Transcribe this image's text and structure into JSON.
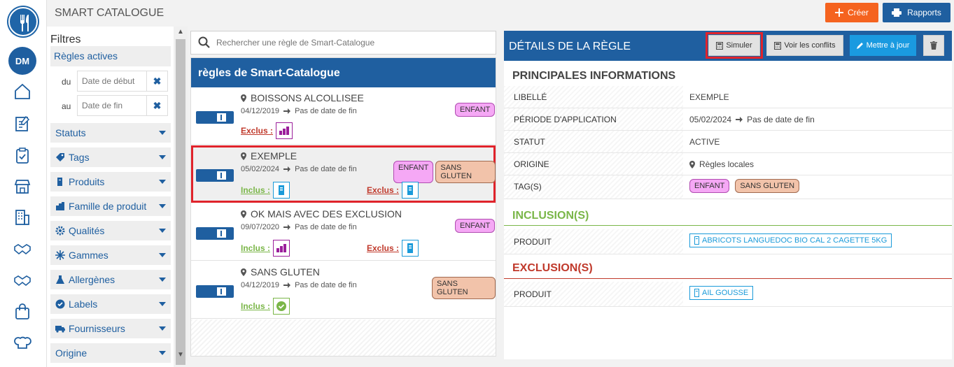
{
  "app": {
    "title": "SMART CATALOGUE",
    "avatar": "DM",
    "create_label": "Créer",
    "reports_label": "Rapports"
  },
  "filters": {
    "title": "Filtres",
    "active_rules": "Règles actives",
    "from_label": "du",
    "from_placeholder": "Date de début",
    "to_label": "au",
    "to_placeholder": "Date de fin",
    "facets": [
      "Statuts",
      "Tags",
      "Produits",
      "Famille de produit",
      "Qualités",
      "Gammes",
      "Allergènes",
      "Labels",
      "Fournisseurs",
      "Origine"
    ]
  },
  "search": {
    "placeholder": "Rechercher une règle de Smart-Catalogue"
  },
  "list": {
    "title": "règles de Smart-Catalogue",
    "no_end": "Pas de date de fin",
    "incl_label": "Inclus :",
    "excl_label": "Exclus :",
    "rules": [
      {
        "name": "BOISSONS ALCOLLISEE",
        "date": "04/12/2019",
        "tags": [
          "ENFANT"
        ]
      },
      {
        "name": "EXEMPLE",
        "date": "05/02/2024",
        "tags": [
          "ENFANT",
          "SANS GLUTEN"
        ]
      },
      {
        "name": "OK MAIS AVEC DES EXCLUSION",
        "date": "09/07/2020",
        "tags": [
          "ENFANT"
        ]
      },
      {
        "name": "SANS GLUTEN",
        "date": "04/12/2019",
        "tags": [
          "SANS GLUTEN"
        ]
      }
    ]
  },
  "detail": {
    "title": "DÉTAILS DE LA RÈGLE",
    "simulate": "Simuler",
    "conflicts": "Voir les conflits",
    "update": "Mettre à jour",
    "main_info": "PRINCIPALES INFORMATIONS",
    "rows": [
      {
        "k": "LIBELLÉ",
        "v": "EXEMPLE"
      },
      {
        "k": "PÉRIODE D'APPLICATION",
        "v": "05/02/2024",
        "v2": "Pas de date de fin"
      },
      {
        "k": "STATUT",
        "v": "ACTIVE"
      },
      {
        "k": "ORIGINE",
        "v": "Règles locales"
      },
      {
        "k": "TAG(S)",
        "tags": [
          "ENFANT",
          "SANS GLUTEN"
        ]
      }
    ],
    "inclusions_title": "INCLUSION(S)",
    "inclusion": {
      "k": "PRODUIT",
      "v": "ABRICOTS LANGUEDOC BIO CAL 2 CAGETTE 5KG"
    },
    "exclusions_title": "EXCLUSION(S)",
    "exclusion": {
      "k": "PRODUIT",
      "v": "AIL GOUSSE"
    }
  },
  "colors": {
    "primary": "#1f5fa0",
    "create": "#f5631f",
    "include": "#7ab648",
    "exclude": "#c0392b",
    "highlight": "#e0232b"
  }
}
